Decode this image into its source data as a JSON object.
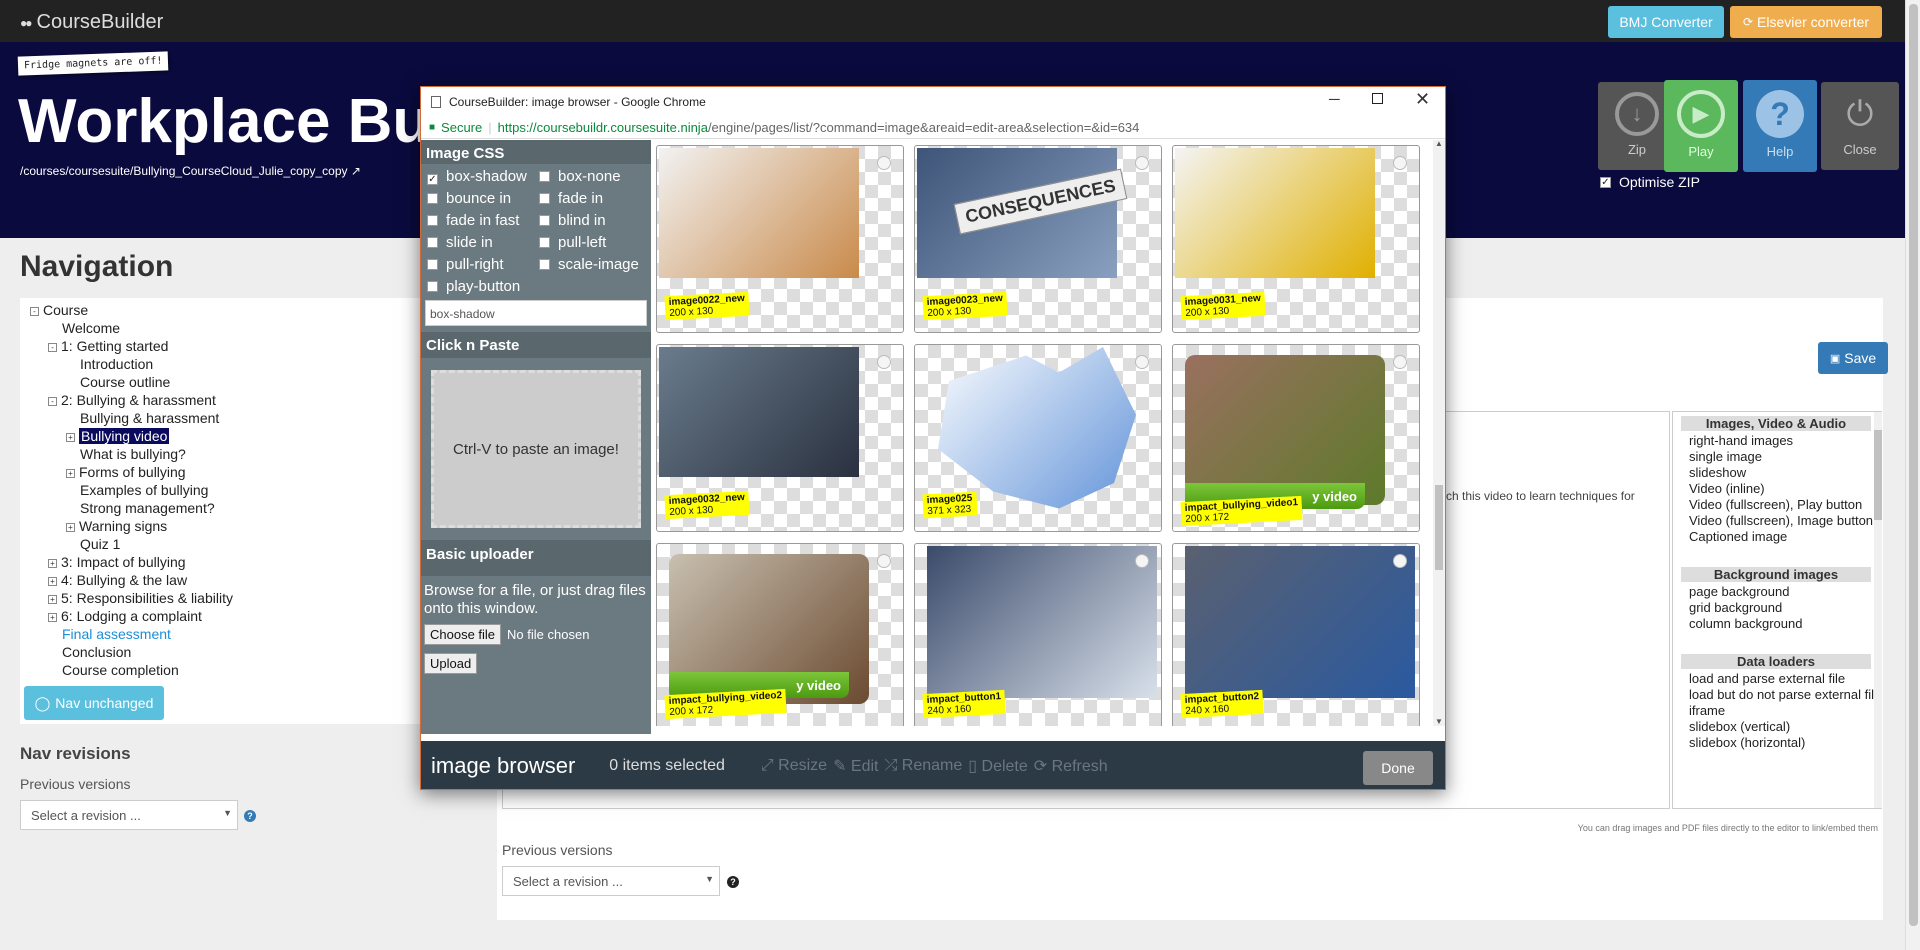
{
  "app": {
    "logo": "CourseBuilder"
  },
  "top_buttons": {
    "bmj": "BMJ Converter",
    "elsevier": "Elsevier converter"
  },
  "header": {
    "sticky_note": "Fridge magnets are off!",
    "title": "Workplace Bullying",
    "path": "/courses/coursesuite/Bullying_CourseCloud_Julie_copy_copy"
  },
  "tools": {
    "zip": "Zip",
    "play": "Play",
    "help": "Help",
    "close": "Close",
    "optimise": "Optimise ZIP"
  },
  "nav": {
    "heading": "Navigation",
    "items": [
      {
        "label": "Course",
        "level": 0,
        "toggle": "-"
      },
      {
        "label": "Welcome",
        "level": 1,
        "toggle": ""
      },
      {
        "label": "1: Getting started",
        "level": 1,
        "toggle": "-"
      },
      {
        "label": "Introduction",
        "level": 2,
        "toggle": ""
      },
      {
        "label": "Course outline",
        "level": 2,
        "toggle": ""
      },
      {
        "label": "2: Bullying & harassment",
        "level": 1,
        "toggle": "-"
      },
      {
        "label": "Bullying & harassment",
        "level": 2,
        "toggle": ""
      },
      {
        "label": "Bullying video",
        "level": 2,
        "toggle": "+",
        "selected": true
      },
      {
        "label": "What is bullying?",
        "level": 2,
        "toggle": ""
      },
      {
        "label": "Forms of bullying",
        "level": 2,
        "toggle": "+"
      },
      {
        "label": "Examples of bullying",
        "level": 2,
        "toggle": ""
      },
      {
        "label": "Strong management?",
        "level": 2,
        "toggle": ""
      },
      {
        "label": "Warning signs",
        "level": 2,
        "toggle": "+"
      },
      {
        "label": "Quiz 1",
        "level": 2,
        "toggle": ""
      },
      {
        "label": "3: Impact of bullying",
        "level": 1,
        "toggle": "+"
      },
      {
        "label": "4: Bullying & the law",
        "level": 1,
        "toggle": "+"
      },
      {
        "label": "5: Responsibilities & liability",
        "level": 1,
        "toggle": "+"
      },
      {
        "label": "6: Lodging a complaint",
        "level": 1,
        "toggle": "+"
      },
      {
        "label": "Final assessment",
        "level": 1,
        "toggle": "",
        "link": true
      },
      {
        "label": "Conclusion",
        "level": 1,
        "toggle": ""
      },
      {
        "label": "Course completion",
        "level": 1,
        "toggle": ""
      }
    ],
    "unchanged_button": "Nav unchanged",
    "revisions_heading": "Nav revisions",
    "previous_versions": "Previous versions",
    "revision_placeholder": "Select a revision ..."
  },
  "editor": {
    "save": "Save",
    "snippet": "ch this video to learn techniques for",
    "drag_hint": "You can drag images and PDF files directly to the editor to link/embed them",
    "previous_versions": "Previous versions",
    "revision_placeholder": "Select a revision ..."
  },
  "sidebox": {
    "sections": [
      {
        "title": "Images, Video & Audio",
        "items": [
          "right-hand images",
          "single image",
          "slideshow",
          "Video (inline)",
          "Video (fullscreen), Play button",
          "Video (fullscreen), Image button",
          "Captioned image"
        ]
      },
      {
        "title": "Background images",
        "items": [
          "page background",
          "grid background",
          "column background"
        ]
      },
      {
        "title": "Data loaders",
        "items": [
          "load and parse external file",
          "load but do not parse external file",
          "iframe",
          "slidebox (vertical)",
          "slidebox (horizontal)"
        ]
      }
    ]
  },
  "popup": {
    "window_title": "CourseBuilder: image browser - Google Chrome",
    "secure": "Secure",
    "url_host": "https://coursebuildr.coursesuite.ninja",
    "url_path": "/engine/pages/list/?command=image&areaid=edit-area&selection=&id=634",
    "css_heading": "Image CSS",
    "css_options": [
      {
        "label": "box-shadow",
        "checked": true
      },
      {
        "label": "box-none",
        "checked": false
      },
      {
        "label": "bounce in",
        "checked": false
      },
      {
        "label": "fade in",
        "checked": false
      },
      {
        "label": "fade in fast",
        "checked": false
      },
      {
        "label": "blind in",
        "checked": false
      },
      {
        "label": "slide in",
        "checked": false
      },
      {
        "label": "pull-left",
        "checked": false
      },
      {
        "label": "pull-right",
        "checked": false
      },
      {
        "label": "scale-image",
        "checked": false
      },
      {
        "label": "play-button",
        "checked": false
      }
    ],
    "css_value": "box-shadow",
    "paste_heading": "Click n Paste",
    "paste_text": "Ctrl-V to paste an image!",
    "uploader_heading": "Basic uploader",
    "uploader_text": "Browse for a file, or just drag files onto this window.",
    "choose_file": "Choose file",
    "no_file": "No file chosen",
    "upload": "Upload",
    "images": [
      {
        "name": "image0022_new",
        "size": "200 x 130"
      },
      {
        "name": "image0023_new",
        "size": "200 x 130",
        "sign": "CONSEQUENCES"
      },
      {
        "name": "image0031_new",
        "size": "200 x 130"
      },
      {
        "name": "image0032_new",
        "size": "200 x 130"
      },
      {
        "name": "image025",
        "size": "371 x 323"
      },
      {
        "name": "impact_bullying_video1",
        "size": "200 x 172",
        "banner": "y video"
      },
      {
        "name": "impact_bullying_video2",
        "size": "200 x 172",
        "banner": "y video"
      },
      {
        "name": "impact_button1",
        "size": "240 x 160"
      },
      {
        "name": "impact_button2",
        "size": "240 x 160"
      }
    ],
    "footer_title": "image browser",
    "items_selected": "0 items selected",
    "actions": {
      "resize": "Resize",
      "edit": "Edit",
      "rename": "Rename",
      "delete": "Delete",
      "refresh": "Refresh"
    },
    "done": "Done"
  },
  "colors": {
    "header_bg": "#0a0a3e",
    "bmj": "#5bc0de",
    "elsevier": "#f0ad4e",
    "play": "#5cb85c",
    "help": "#337ab7",
    "save": "#337ab7",
    "popup_panel": "#6b7a80",
    "popup_footer": "#2b3a45"
  }
}
